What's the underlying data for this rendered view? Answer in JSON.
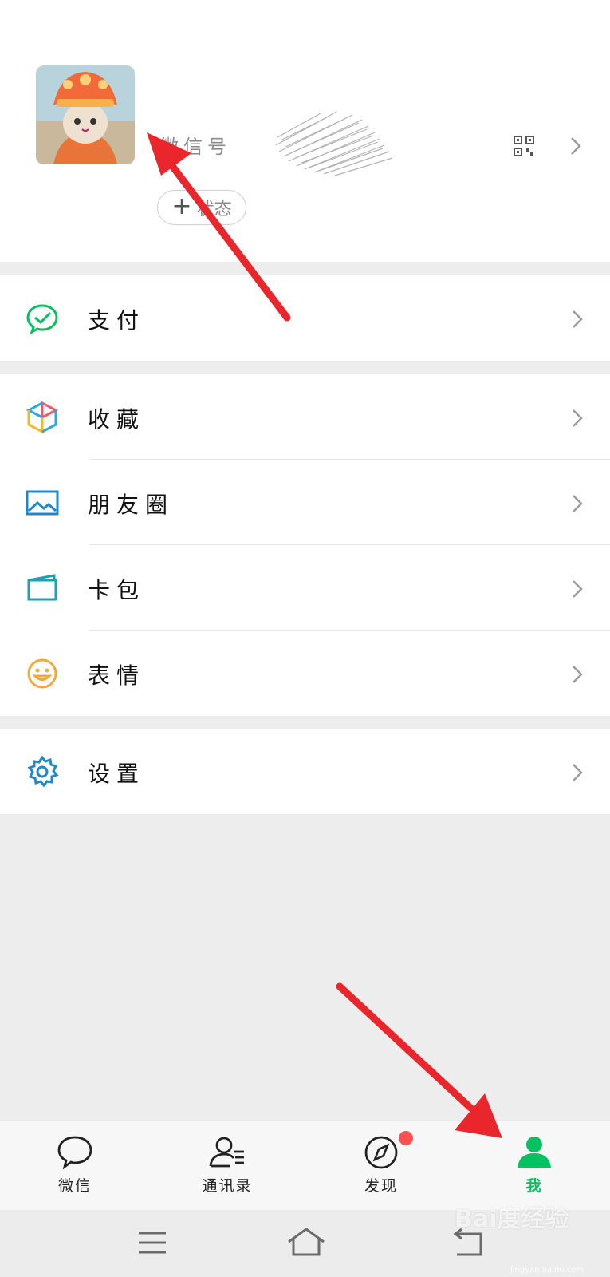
{
  "profile": {
    "wxid_label": "微信号",
    "status_label": "状态",
    "status_plus": "+"
  },
  "menu": {
    "pay": "支付",
    "favorites": "收藏",
    "moments": "朋友圈",
    "cards": "卡包",
    "stickers": "表情",
    "settings": "设置"
  },
  "tabbar": {
    "chats": "微信",
    "contacts": "通讯录",
    "discover": "发现",
    "me": "我"
  },
  "watermark": {
    "brand": "Bai度经验",
    "url": "jingyan.baidu.com"
  },
  "colors": {
    "accent": "#07c160",
    "badge": "#fa5151",
    "arrow": "#e8262c"
  },
  "icons": {
    "pay": "wechat-pay-icon",
    "favorites": "cube-icon",
    "moments": "picture-icon",
    "cards": "card-wallet-icon",
    "stickers": "smiley-icon",
    "settings": "gear-icon"
  }
}
